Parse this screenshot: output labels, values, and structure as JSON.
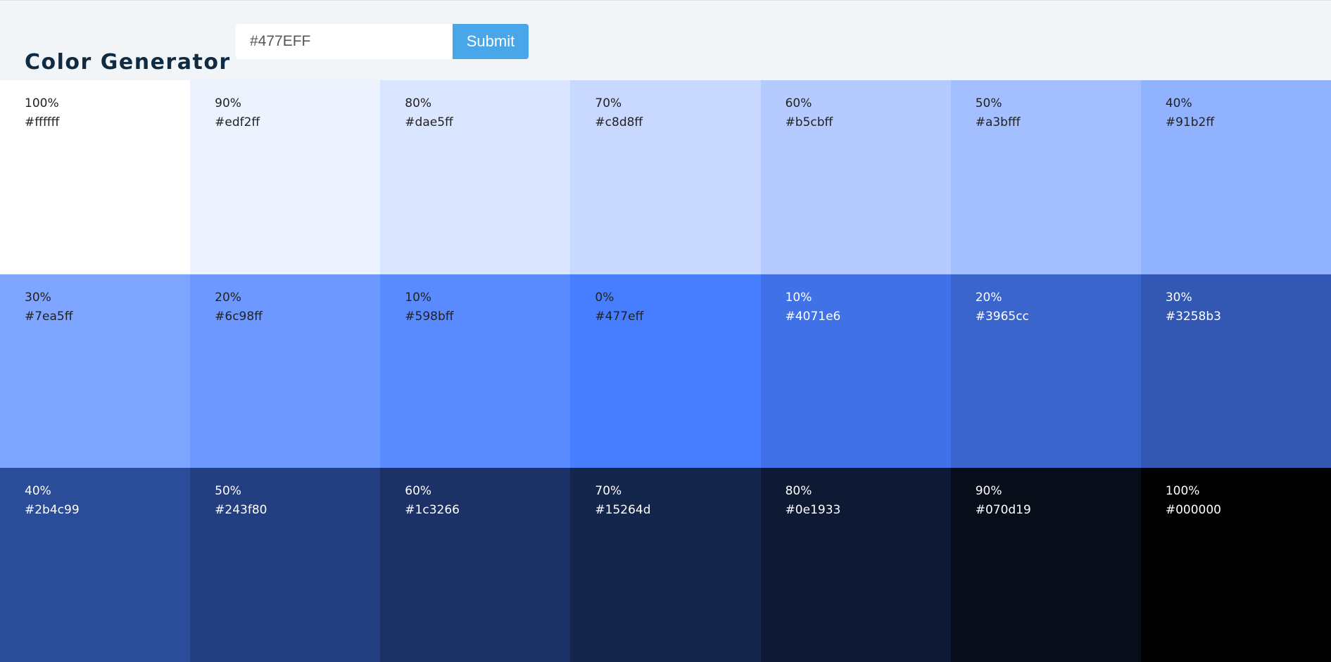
{
  "header": {
    "title": "Color Generator",
    "input_value": "#477EFF",
    "submit_label": "Submit"
  },
  "colors": {
    "dark_text": "#222222",
    "light_text": "#ffffff",
    "title": "#102a42",
    "submit_button": "#49a6e9",
    "background": "#f1f5f8"
  },
  "swatches": [
    {
      "weight": "100%",
      "hex": "#ffffff",
      "tone": "tint"
    },
    {
      "weight": "90%",
      "hex": "#edf2ff",
      "tone": "tint"
    },
    {
      "weight": "80%",
      "hex": "#dae5ff",
      "tone": "tint"
    },
    {
      "weight": "70%",
      "hex": "#c8d8ff",
      "tone": "tint"
    },
    {
      "weight": "60%",
      "hex": "#b5cbff",
      "tone": "tint"
    },
    {
      "weight": "50%",
      "hex": "#a3bfff",
      "tone": "tint"
    },
    {
      "weight": "40%",
      "hex": "#91b2ff",
      "tone": "tint"
    },
    {
      "weight": "30%",
      "hex": "#7ea5ff",
      "tone": "tint"
    },
    {
      "weight": "20%",
      "hex": "#6c98ff",
      "tone": "tint"
    },
    {
      "weight": "10%",
      "hex": "#598bff",
      "tone": "tint"
    },
    {
      "weight": "0%",
      "hex": "#477eff",
      "tone": "base"
    },
    {
      "weight": "10%",
      "hex": "#4071e6",
      "tone": "shade"
    },
    {
      "weight": "20%",
      "hex": "#3965cc",
      "tone": "shade"
    },
    {
      "weight": "30%",
      "hex": "#3258b3",
      "tone": "shade"
    },
    {
      "weight": "40%",
      "hex": "#2b4c99",
      "tone": "shade"
    },
    {
      "weight": "50%",
      "hex": "#243f80",
      "tone": "shade"
    },
    {
      "weight": "60%",
      "hex": "#1c3266",
      "tone": "shade"
    },
    {
      "weight": "70%",
      "hex": "#15264d",
      "tone": "shade"
    },
    {
      "weight": "80%",
      "hex": "#0e1933",
      "tone": "shade"
    },
    {
      "weight": "90%",
      "hex": "#070d19",
      "tone": "shade"
    },
    {
      "weight": "100%",
      "hex": "#000000",
      "tone": "shade"
    }
  ]
}
